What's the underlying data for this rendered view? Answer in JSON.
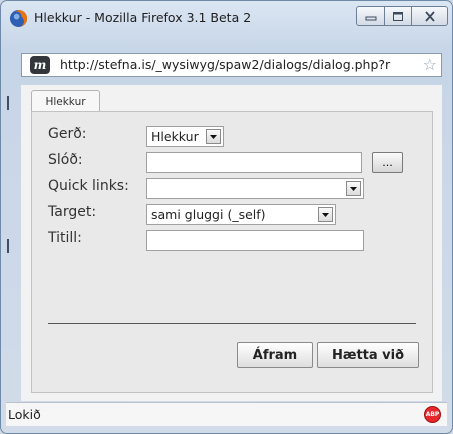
{
  "window": {
    "title": "Hlekkur - Mozilla Firefox 3.1 Beta 2",
    "controls": [
      "minimize-icon",
      "maximize-icon",
      "close-icon"
    ]
  },
  "urlbar": {
    "site_icon_letter": "m",
    "url": "http://stefna.is/_wysiwyg/spaw2/dialogs/dialog.php?r",
    "bookmark_icon": "star-icon"
  },
  "dialog": {
    "tab_label": "Hlekkur",
    "fields": {
      "gerd_label": "Gerð:",
      "gerd_value": "Hlekkur",
      "slod_label": "Slóð:",
      "slod_value": "",
      "browse_label": "...",
      "quicklinks_label": "Quick links:",
      "quicklinks_value": "",
      "target_label": "Target:",
      "target_value": "sami gluggi (_self)",
      "titill_label": "Titill:",
      "titill_value": ""
    },
    "buttons": {
      "ok": "Áfram",
      "cancel": "Hætta við"
    }
  },
  "statusbar": {
    "text": "Lokið",
    "addon_icon": "adblock-plus-icon",
    "addon_label": "ABP"
  }
}
